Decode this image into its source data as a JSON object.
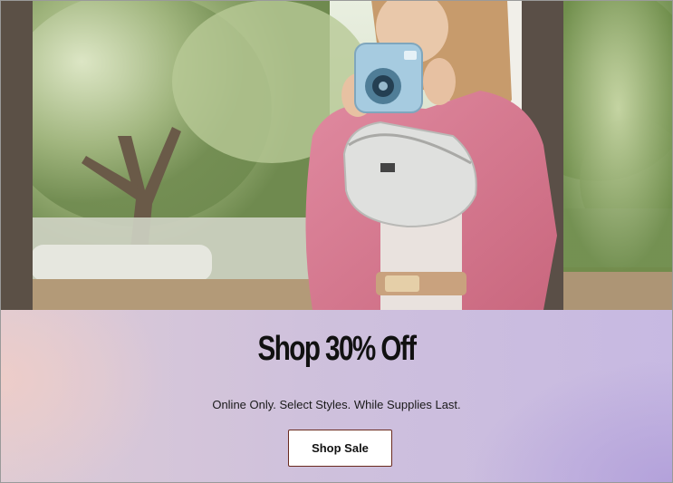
{
  "hero": {
    "media_type": "video"
  },
  "promo": {
    "title": "Shop 30% Off",
    "subtitle": "Online Only. Select Styles. While Supplies Last.",
    "button_label": "Shop Sale"
  },
  "colors": {
    "button_border": "#6a2a1e",
    "title_text": "#111111",
    "gradient_left": "#eecdc8",
    "gradient_right": "#b2a0da"
  }
}
